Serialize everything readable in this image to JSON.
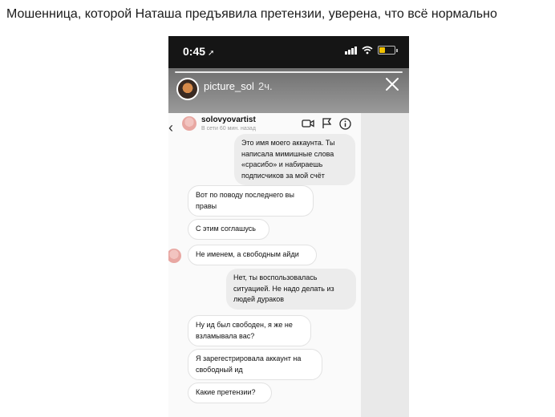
{
  "caption": "Мошенница, которой Наташа предъявила претензии, уверена, что всё нормально",
  "status_bar": {
    "time": "0:45"
  },
  "story": {
    "username": "picture_sol",
    "time_ago": "2ч."
  },
  "dm": {
    "username": "solovyovartist",
    "status": "В сети 60 мин. назад"
  },
  "messages": [
    {
      "side": "out",
      "text": "Это имя моего аккаунта. Ты написала мимишные слова «срасибо» и набираешь подписчиков за мой счёт"
    },
    {
      "side": "in",
      "text": "Вот по поводу последнего вы правы"
    },
    {
      "side": "in",
      "text": "С этим соглашусь"
    },
    {
      "side": "in",
      "text": "Не именем, а свободным айди"
    },
    {
      "side": "out",
      "text": "Нет, ты воспользовалась ситуацией. Не надо делать из людей дураков"
    },
    {
      "side": "in",
      "text": "Ну ид был свободен, я же не взламывала вас?"
    },
    {
      "side": "in",
      "text": "Я зарегестрировала аккаунт на свободный ид"
    },
    {
      "side": "in",
      "text": "Какие претензии?"
    }
  ],
  "colors": {
    "status_bar": "#151515",
    "story_header": "#8a8a8a",
    "incoming_bubble": "#ffffff",
    "outgoing_bubble": "#ececec"
  },
  "icons": [
    "location-arrow-icon",
    "signal-icon",
    "wifi-icon",
    "battery-icon",
    "close-icon",
    "back-icon",
    "video-call-icon",
    "flag-icon",
    "info-icon"
  ]
}
